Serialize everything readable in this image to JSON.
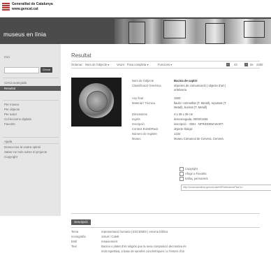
{
  "header": {
    "org_name": "Generalitat de Catalunya",
    "org_url": "www.gencat.cat"
  },
  "banner": {
    "title": "museus en línia"
  },
  "sidebar": {
    "home": "Inici",
    "search_button": "Cercar",
    "advanced_search": "Cerca avançada",
    "result": "Resultat",
    "browse": [
      "Per museu",
      "Per objecte",
      "Per autor",
      "Col·leccions digitals",
      "Favorits"
    ],
    "help": [
      "Ajuda",
      "Doneu-nos la vostra opinió",
      "Saber-ne més sobre el projecte",
      "Copyright"
    ]
  },
  "main": {
    "title": "Resultat",
    "sort_bar": {
      "label": "Ordenar:",
      "sort_value": "Nom de l'objecte ▾",
      "view_label": "Veure:",
      "view_value": "Fitxa completa ▾",
      "functions": "Funcions ▾"
    },
    "pagination": {
      "current": "43",
      "of_label": "de",
      "total": "2260"
    },
    "record": [
      {
        "label": "Nom de l'objecte",
        "value": "Bacina de captiri",
        "bold": true
      },
      {
        "label": "Classificació Genèrica",
        "value": "objectes de comunicació | objecte d'art |",
        "value2": "orfebreria"
      },
      {
        "label": "Any final",
        "value": "1500"
      },
      {
        "label": "Material / Tècnica",
        "value": "llautó / emmotllat (T. Metall), repussat (T.",
        "value2": "Metall), burinat (T. Metall)"
      },
      {
        "label": "Dimensions",
        "value": "4 x 39 x 39 cm"
      },
      {
        "label": "Ingrés",
        "value": "desconeguda, 00/00/1936"
      },
      {
        "label": "Inscripció",
        "value": "inscripció: - DEH - NFRIDDEM WART:"
      },
      {
        "label": "Context EUMDRack",
        "value": "objecte litúrgic"
      },
      {
        "label": "Número de registre",
        "value": "1234"
      },
      {
        "label": "Museu",
        "value": "Museu Comarcal de Cervera. Cervera"
      }
    ],
    "links": {
      "copyright": "Copyright",
      "add_favorites": "Afegir a Favorits",
      "permalink_label": "Enllaç permanent",
      "permalink_url": "http://museusenlinia.gencat.cat/eMPlaMuseusPlus?o="
    },
    "description_tab": "Descripció",
    "description": [
      {
        "label": "Tema",
        "value": "representació humana | ESCENES | escena bíblica"
      },
      {
        "label": "Iconografia",
        "value": "Josuè i Caleb"
      },
      {
        "label": "Estil",
        "value": "renaixement"
      },
      {
        "label": "Text",
        "value": "Bacina o platet d'ús religiós que la seva composició decorativa és"
      },
      {
        "label": "",
        "value": "molt repetitiva, a base de sanefes concèntriques i a l'entorn d'un"
      }
    ]
  },
  "colors": {
    "accent": "#c9302c",
    "banner": "#4b4b4b",
    "sidebar": "#e6e6e6"
  }
}
